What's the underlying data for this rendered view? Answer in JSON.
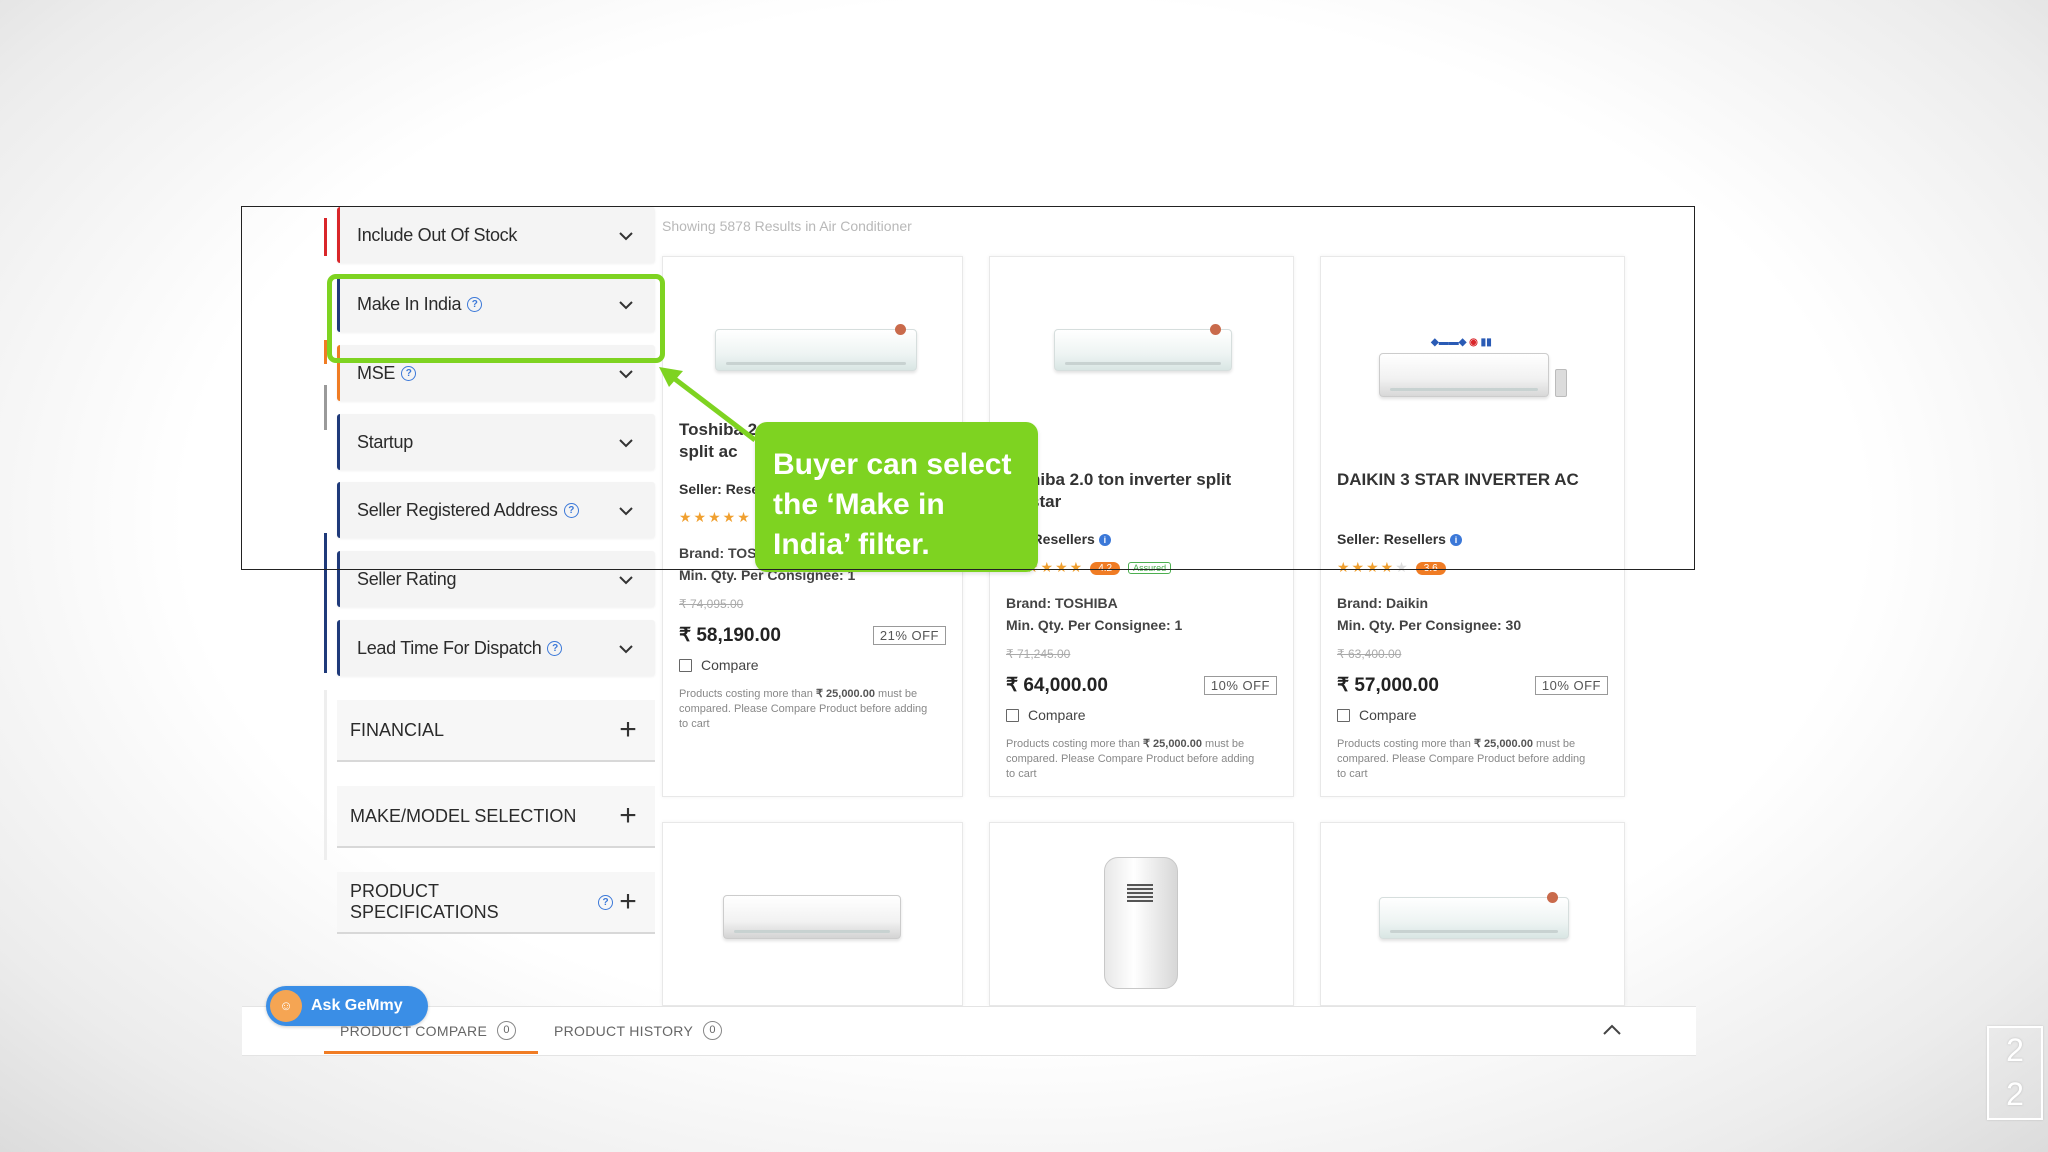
{
  "results_text": "Showing 5878 Results in Air Conditioner",
  "filters": [
    {
      "label": "Include Out Of Stock",
      "help": false
    },
    {
      "label": "Make In India",
      "help": true
    },
    {
      "label": "MSE",
      "help": true
    },
    {
      "label": "Startup",
      "help": false
    },
    {
      "label": "Seller Registered Address",
      "help": true
    },
    {
      "label": "Seller Rating",
      "help": false
    },
    {
      "label": "Lead Time For Dispatch",
      "help": true
    }
  ],
  "sections": [
    {
      "label": "FINANCIAL",
      "help": false
    },
    {
      "label": "MAKE/MODEL SELECTION",
      "help": false
    },
    {
      "label": "PRODUCT SPECIFICATIONS",
      "help": true
    }
  ],
  "products": [
    {
      "title_line1": "Toshiba 2",
      "title_line2": "split ac",
      "seller": "Seller: Resellers",
      "rating": "4.2",
      "brand": "Brand: TOSHIBA",
      "min_qty": "Min. Qty. Per Consignee: 1",
      "mrp": "₹ 74,095.00",
      "price": "₹ 58,190.00",
      "off": "21% OFF",
      "compare": "Compare",
      "note_prefix": "Products costing more than",
      "note_amount": "₹ 25,000.00",
      "note_suffix": "must be compared. Please Compare Product before adding to cart"
    },
    {
      "title_line1": "hiba 2.0 ton inverter split",
      "title_line2": "star",
      "seller": ": Resellers",
      "rating": "4.2",
      "assured": "Assured",
      "brand": "Brand: TOSHIBA",
      "min_qty": "Min. Qty. Per Consignee: 1",
      "mrp": "₹ 71,245.00",
      "price": "₹ 64,000.00",
      "off": "10% OFF",
      "compare": "Compare",
      "note_prefix": "Products costing more than",
      "note_amount": "₹ 25,000.00",
      "note_suffix": "must be compared. Please Compare Product before adding to cart"
    },
    {
      "title_line1": "DAIKIN 3 STAR INVERTER AC",
      "title_line2": "",
      "seller": "Seller: Resellers",
      "rating": "3.6",
      "brand": "Brand: Daikin",
      "min_qty": "Min. Qty. Per Consignee: 30",
      "mrp": "₹ 63,400.00",
      "price": "₹ 57,000.00",
      "off": "10% OFF",
      "compare": "Compare",
      "note_prefix": "Products costing more than",
      "note_amount": "₹ 25,000.00",
      "note_suffix": "must be compared. Please Compare Product before adding to cart"
    }
  ],
  "callout": {
    "line1": "Buyer can select",
    "line2": "the ‘Make in",
    "line3": "India’ filter."
  },
  "ask_gemmy": "Ask GeMmy",
  "bottom_tabs": [
    {
      "label": "PRODUCT COMPARE",
      "count": "0"
    },
    {
      "label": "PRODUCT HISTORY",
      "count": "0"
    }
  ],
  "slide_number": {
    "top": "2",
    "bottom": "2"
  },
  "colors": {
    "highlight": "#7ed321",
    "accent_orange": "#f07c24",
    "link_blue": "#3b78d8"
  }
}
